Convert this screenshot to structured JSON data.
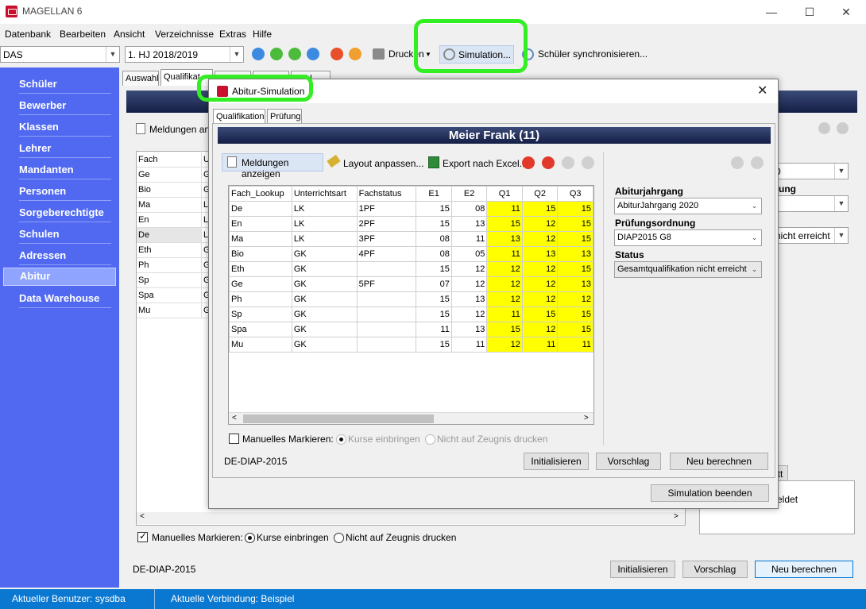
{
  "window": {
    "title": "MAGELLAN 6",
    "minimize": "—",
    "maximize": "☐",
    "close": "✕"
  },
  "menu": [
    "Datenbank",
    "Bearbeiten",
    "Ansicht",
    "Verzeichnisse",
    "Extras",
    "Hilfe"
  ],
  "toolbar": {
    "school": "DAS",
    "term": "1. HJ 2018/2019",
    "print_label": "Drucken",
    "simulation_label": "Simulation...",
    "sync_label": "Schüler synchronisieren..."
  },
  "sidebar": {
    "items": [
      {
        "label": "Schüler"
      },
      {
        "label": "Bewerber"
      },
      {
        "label": "Klassen"
      },
      {
        "label": "Lehrer"
      },
      {
        "label": "Mandanten"
      },
      {
        "label": "Personen"
      },
      {
        "label": "Sorgeberechtigte"
      },
      {
        "label": "Schulen"
      },
      {
        "label": "Adressen"
      },
      {
        "label": "Abitur",
        "active": true
      },
      {
        "label": "Data Warehouse"
      }
    ]
  },
  "background": {
    "tabs": [
      "Auswahl",
      "Qualifikat",
      "",
      "",
      "wahl"
    ],
    "meldungen_label": "Meldungen anz",
    "grid_header": [
      "Fach",
      "U"
    ],
    "grid_rows": [
      [
        "Ge",
        "G"
      ],
      [
        "Bio",
        "G"
      ],
      [
        "Ma",
        "LK"
      ],
      [
        "En",
        "LK"
      ],
      [
        "De",
        "LK"
      ],
      [
        "Eth",
        "G"
      ],
      [
        "Ph",
        "G"
      ],
      [
        "Sp",
        "G"
      ],
      [
        "Spa",
        "G"
      ],
      [
        "Mu",
        "G"
      ]
    ],
    "right_fields": [
      "0",
      "ung",
      "nicht erreicht"
    ],
    "tt_label": "tt",
    "meldet_label": "eldet",
    "manual_mark_label": "Manuelles Markieren:",
    "courses_label": "Kurse einbringen",
    "not_on_report_label": "Nicht auf Zeugnis drucken",
    "footer_code": "DE-DIAP-2015",
    "init_btn": "Initialisieren",
    "propose_btn": "Vorschlag",
    "recalc_btn": "Neu berechnen"
  },
  "modal": {
    "title": "Abitur-Simulation",
    "tabs": [
      "Qualifikation",
      "Prüfung"
    ],
    "student": "Meier Frank (11)",
    "toolbar": {
      "messages": "Meldungen anzeigen",
      "layout": "Layout anpassen...",
      "export": "Export nach Excel..."
    },
    "grid": {
      "headers": [
        "Fach_Lookup",
        "Unterrichtsart",
        "Fachstatus",
        "E1",
        "E2",
        "Q1",
        "Q2",
        "Q3"
      ],
      "rows": [
        [
          "De",
          "LK",
          "1PF",
          "15",
          "08",
          "11",
          "15",
          "15"
        ],
        [
          "En",
          "LK",
          "2PF",
          "15",
          "13",
          "15",
          "12",
          "15"
        ],
        [
          "Ma",
          "LK",
          "3PF",
          "08",
          "11",
          "13",
          "12",
          "15"
        ],
        [
          "Bio",
          "GK",
          "4PF",
          "08",
          "05",
          "11",
          "13",
          "13"
        ],
        [
          "Eth",
          "GK",
          "",
          "15",
          "12",
          "12",
          "12",
          "15"
        ],
        [
          "Ge",
          "GK",
          "5PF",
          "07",
          "12",
          "12",
          "12",
          "13"
        ],
        [
          "Ph",
          "GK",
          "",
          "15",
          "13",
          "12",
          "12",
          "12"
        ],
        [
          "Sp",
          "GK",
          "",
          "15",
          "12",
          "11",
          "15",
          "15"
        ],
        [
          "Spa",
          "GK",
          "",
          "11",
          "13",
          "15",
          "12",
          "15"
        ],
        [
          "Mu",
          "GK",
          "",
          "15",
          "11",
          "12",
          "11",
          "11"
        ]
      ]
    },
    "manual_mark_label": "Manuelles Markieren:",
    "courses_label": "Kurse einbringen",
    "not_on_report_label": "Nicht auf Zeugnis drucken",
    "abiturjahrgang_label": "Abiturjahrgang",
    "abiturjahrgang_value": "AbiturJahrgang 2020",
    "pruefungsordnung_label": "Prüfungsordnung",
    "pruefungsordnung_value": "DIAP2015 G8",
    "status_label": "Status",
    "status_value": "Gesamtqualifikation nicht erreicht",
    "footer_code": "DE-DIAP-2015",
    "init_btn": "Initialisieren",
    "propose_btn": "Vorschlag",
    "recalc_btn": "Neu berechnen",
    "end_btn": "Simulation beenden"
  },
  "statusbar": {
    "user": "Aktueller Benutzer: sysdba",
    "connection": "Aktuelle Verbindung: Beispiel"
  },
  "colors": {
    "sidebar": "#5069f0",
    "highlight": "#33ee22",
    "q_cells": "#ffff00",
    "statusbar": "#0a78d1"
  }
}
